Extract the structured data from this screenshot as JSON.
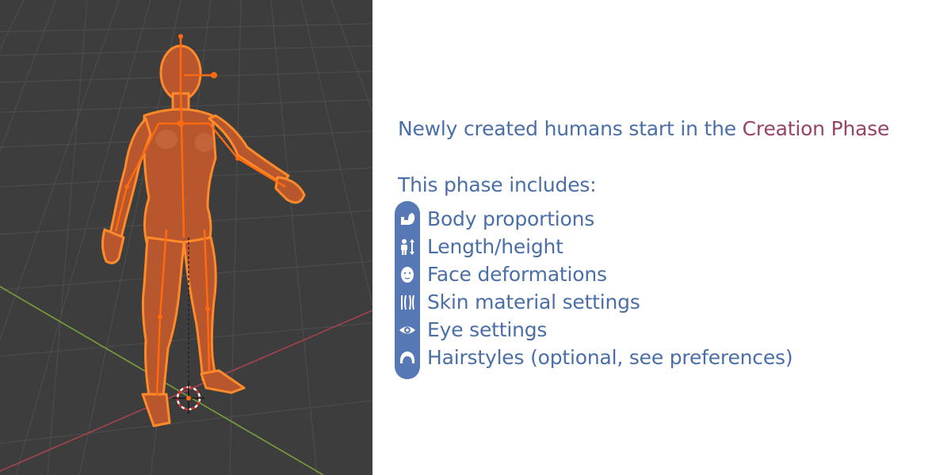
{
  "headline": {
    "prefix": "Newly created humans start in the ",
    "highlight": "Creation Phase"
  },
  "subheading": "This phase includes:",
  "features": [
    {
      "icon": "flexed-arm-icon",
      "label": "Body proportions"
    },
    {
      "icon": "height-person-icon",
      "label": "Length/height"
    },
    {
      "icon": "face-icon",
      "label": "Face deformations"
    },
    {
      "icon": "skin-strands-icon",
      "label": "Skin material settings"
    },
    {
      "icon": "eye-icon",
      "label": "Eye settings"
    },
    {
      "icon": "hair-icon",
      "label": "Hairstyles (optional, see preferences)"
    }
  ],
  "colors": {
    "text": "#4a6ea8",
    "accent": "#98426a",
    "icon_strip": "#5678b4",
    "viewport_bg": "#3d3d3d",
    "selection_orange": "#f36a1a"
  }
}
